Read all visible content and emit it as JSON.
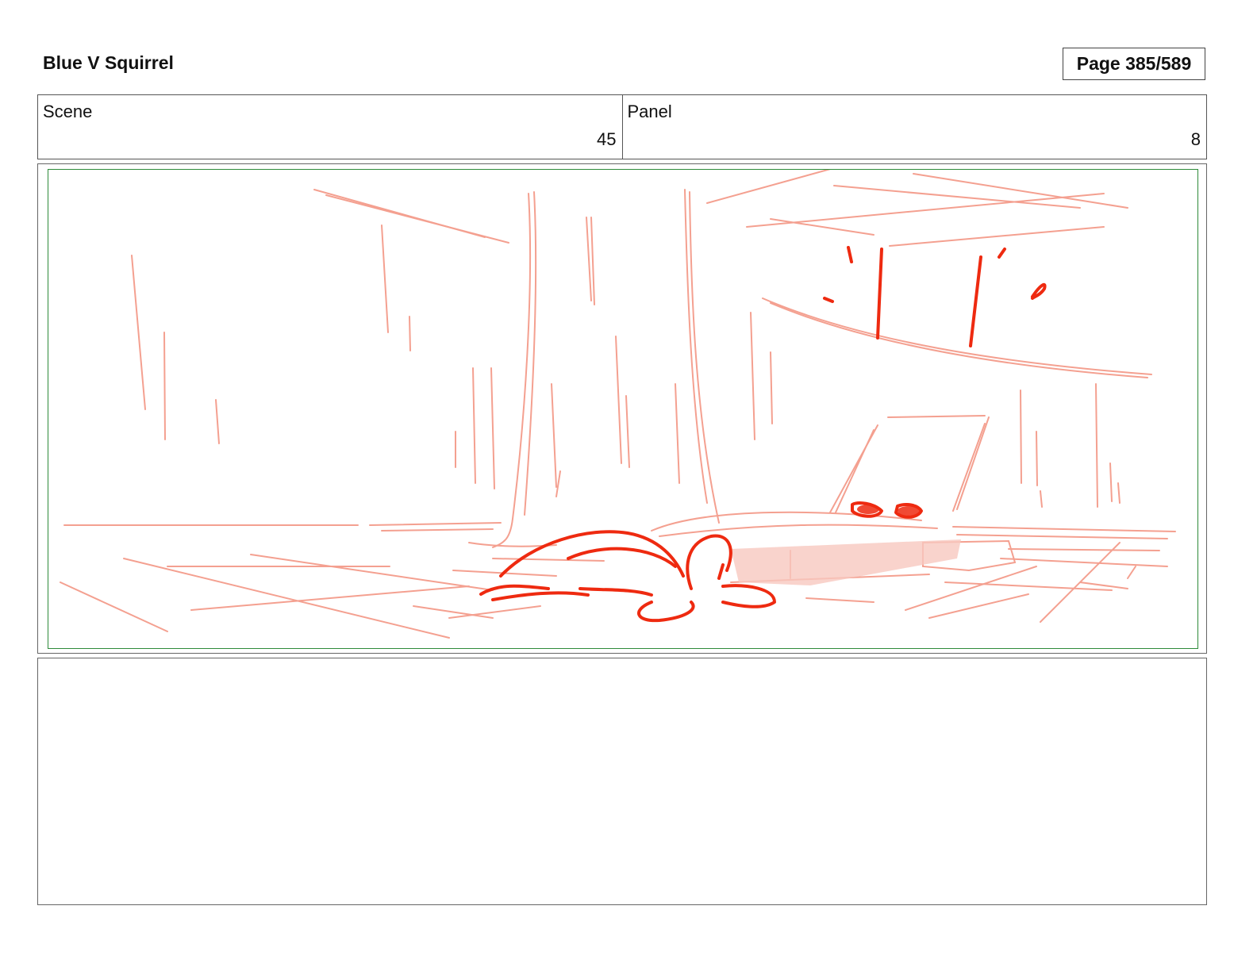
{
  "header": {
    "title": "Blue V Squirrel",
    "page_label": "Page 385/589"
  },
  "info": {
    "scene_label": "Scene",
    "scene_value": "45",
    "panel_label": "Panel",
    "panel_value": "8"
  },
  "panel_image": {
    "description_icon": "storyboard-sketch",
    "line_color": "#f4a090",
    "accent_color": "#ee2a10",
    "frame_color": "#2e8b3a"
  },
  "notes": {
    "text": ""
  }
}
